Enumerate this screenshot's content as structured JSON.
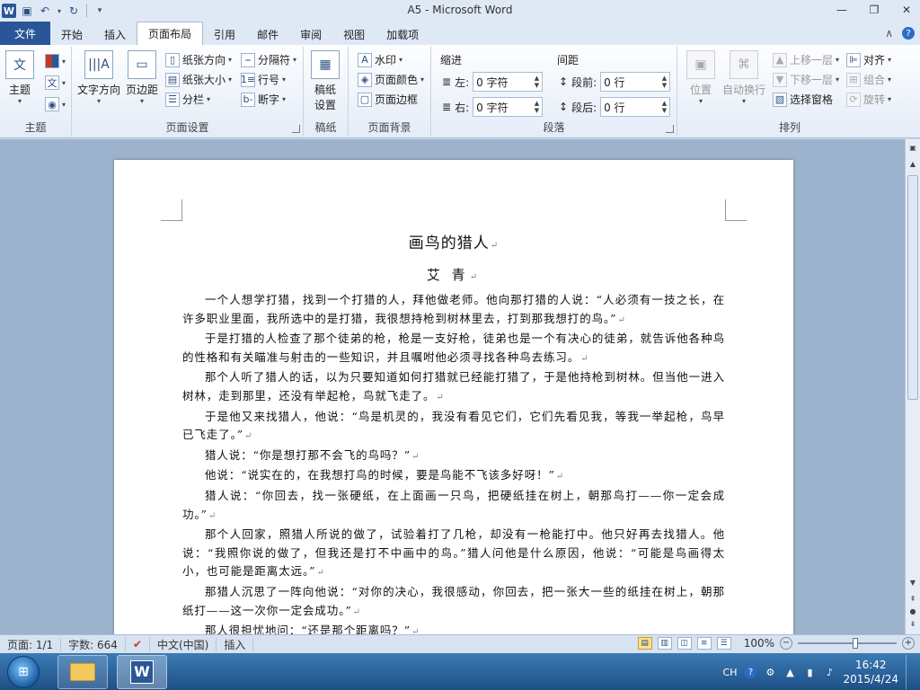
{
  "window": {
    "title": "A5 - Microsoft Word",
    "logo": "W"
  },
  "tabs": {
    "file": "文件",
    "items": [
      "开始",
      "插入",
      "页面布局",
      "引用",
      "邮件",
      "审阅",
      "视图",
      "加载项"
    ],
    "active_index": 2
  },
  "ribbon": {
    "theme": {
      "label": "主题",
      "btn_label": "主题"
    },
    "page_setup": {
      "label": "页面设置",
      "text_direction": "文字方向",
      "margins": "页边距",
      "orientation": "纸张方向",
      "size": "纸张大小",
      "columns": "分栏",
      "breaks": "分隔符",
      "line_numbers": "行号",
      "hyphenation": "断字"
    },
    "draft": {
      "label": "稿纸",
      "btn_label_line1": "稿纸",
      "btn_label_line2": "设置"
    },
    "page_background": {
      "label": "页面背景",
      "watermark": "水印",
      "page_color": "页面颜色",
      "page_borders": "页面边框"
    },
    "paragraph": {
      "label": "段落",
      "indent_header": "缩进",
      "spacing_header": "间距",
      "left_label": "左:",
      "right_label": "右:",
      "before_label": "段前:",
      "after_label": "段后:",
      "left_value": "0 字符",
      "right_value": "0 字符",
      "before_value": "0 行",
      "after_value": "0 行"
    },
    "arrange": {
      "label": "排列",
      "position": "位置",
      "wrap_text": "自动换行",
      "bring_forward": "上移一层",
      "send_backward": "下移一层",
      "selection_pane": "选择窗格",
      "align": "对齐",
      "group": "组合",
      "rotate": "旋转"
    }
  },
  "document": {
    "title": "画鸟的猎人",
    "author": "艾 青",
    "paragraphs": [
      "一个人想学打猎，找到一个打猎的人，拜他做老师。他向那打猎的人说：“人必须有一技之长，在许多职业里面，我所选中的是打猎，我很想持枪到树林里去，打到那我想打的鸟。”",
      "于是打猎的人检查了那个徒弟的枪，枪是一支好枪，徒弟也是一个有决心的徒弟，就告诉他各种鸟的性格和有关瞄准与射击的一些知识，并且嘱咐他必须寻找各种鸟去练习。",
      "那个人听了猎人的话，以为只要知道如何打猎就已经能打猎了，于是他持枪到树林。但当他一进入树林，走到那里，还没有举起枪，鸟就飞走了。",
      "于是他又来找猎人，他说：“鸟是机灵的，我没有看见它们，它们先看见我，等我一举起枪，鸟早已飞走了。”",
      "猎人说：“你是想打那不会飞的鸟吗？”",
      "他说：“说实在的，在我想打鸟的时候，要是鸟能不飞该多好呀！”",
      "猎人说：“你回去，找一张硬纸，在上面画一只鸟，把硬纸挂在树上，朝那鸟打——你一定会成功。”",
      "那个人回家，照猎人所说的做了，试验着打了几枪，却没有一枪能打中。他只好再去找猎人。他说：“我照你说的做了，但我还是打不中画中的鸟。”猎人问他是什么原因，他说：“可能是鸟画得太小，也可能是距离太远。”",
      "那猎人沉思了一阵向他说：“对你的决心，我很感动，你回去，把一张大一些的纸挂在树上，朝那纸打——这一次你一定会成功。”",
      "那人很担忧地问：“还是那个距离吗？”"
    ]
  },
  "status": {
    "page": "页面: 1/1",
    "words": "字数: 664",
    "language": "中文(中国)",
    "insert_mode": "插入",
    "zoom": "100%"
  },
  "taskbar": {
    "ime": "CH",
    "time": "16:42",
    "date": "2015/4/24"
  }
}
